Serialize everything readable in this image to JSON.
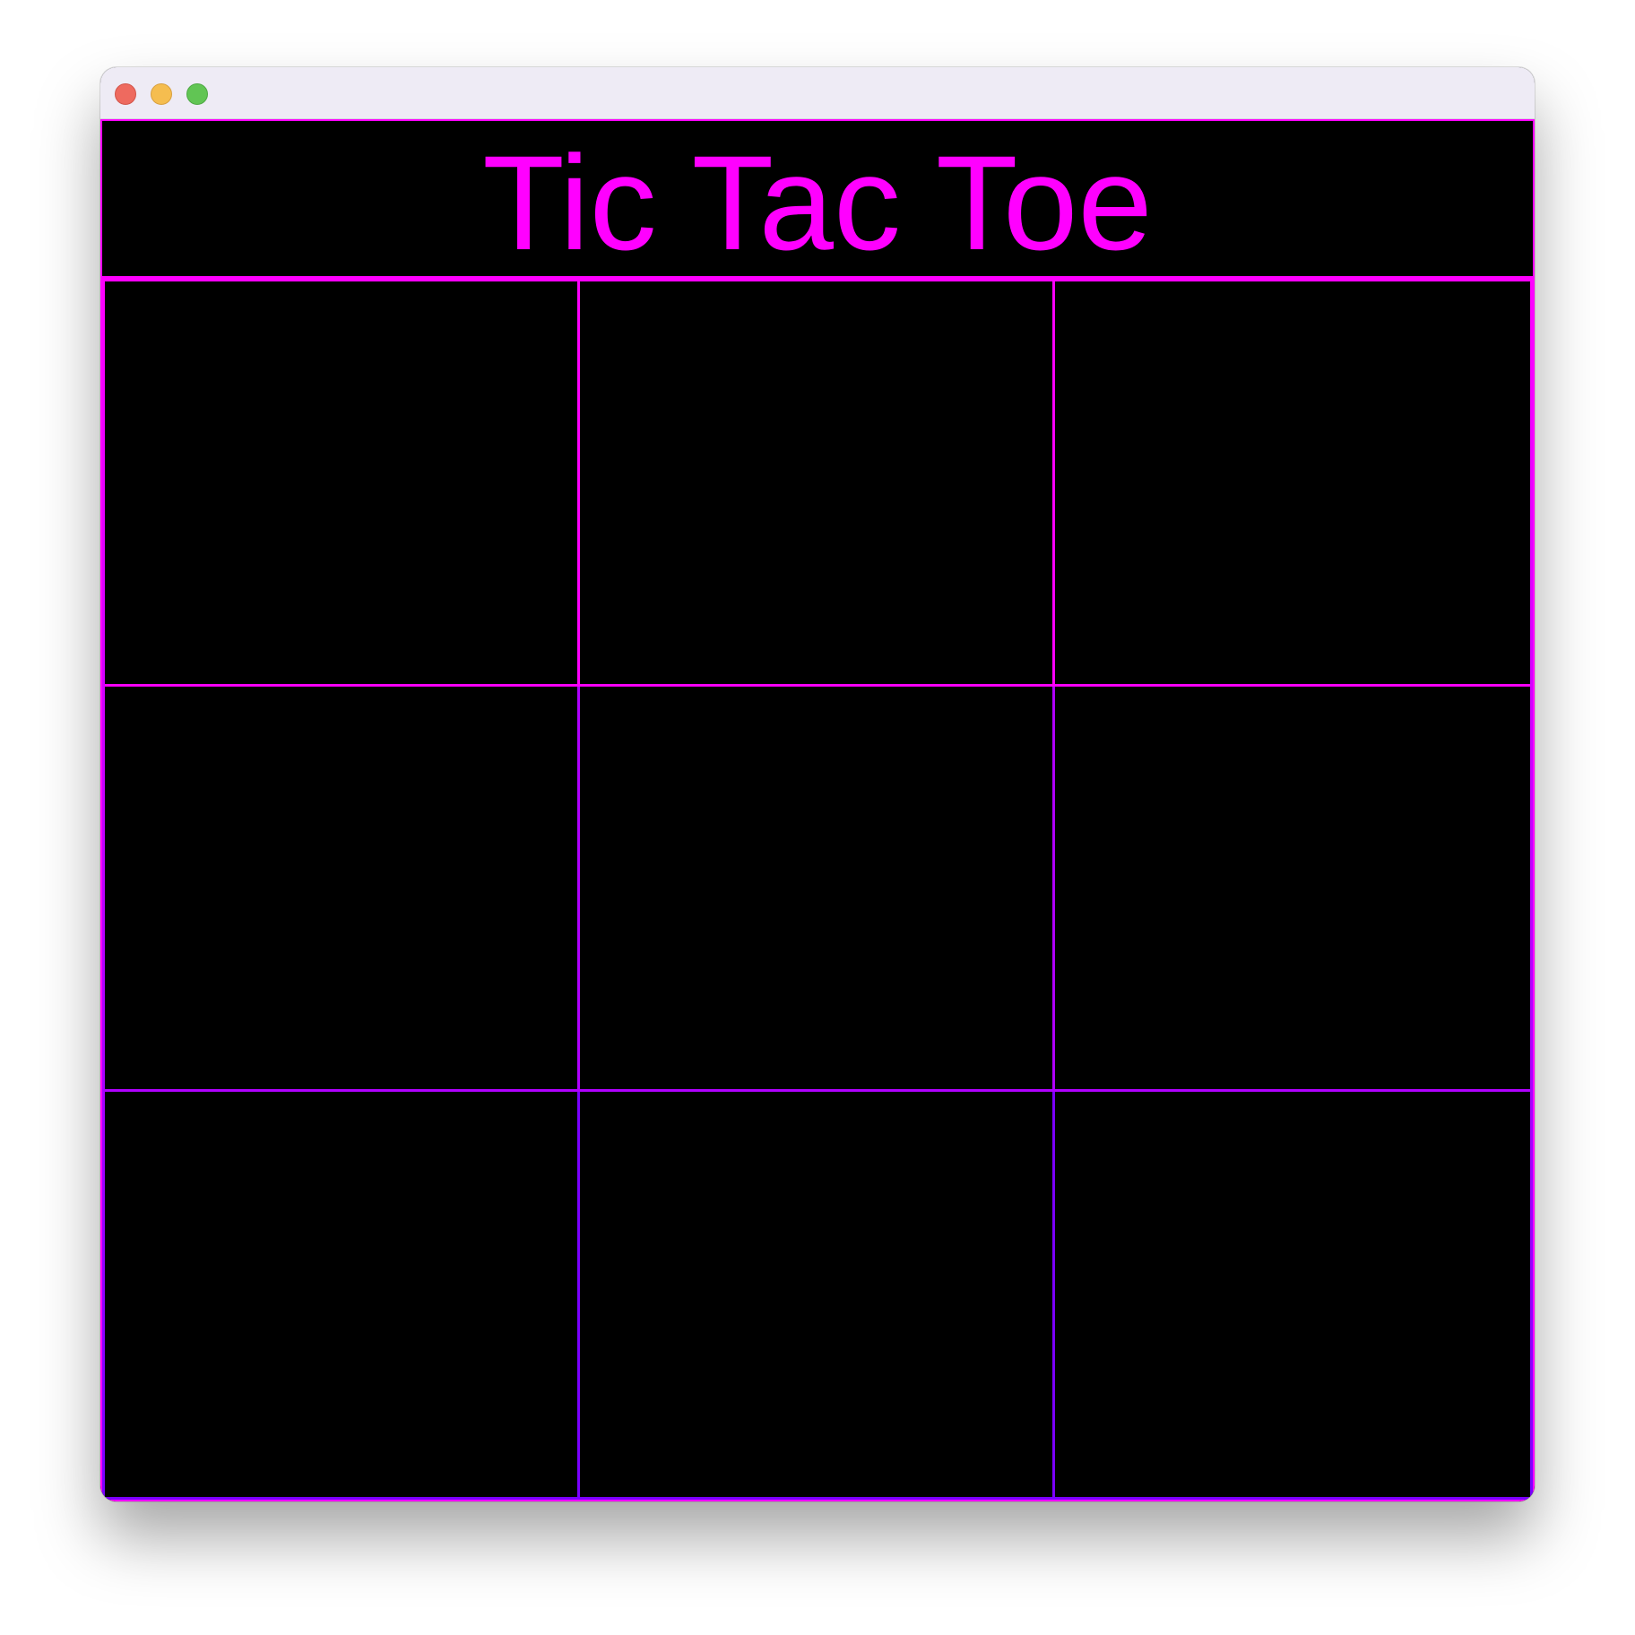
{
  "window": {
    "traffic_lights": [
      "close",
      "minimize",
      "maximize"
    ],
    "colors": {
      "close": "#ee6a5f",
      "minimize": "#f5bd4f",
      "maximize": "#61c554"
    }
  },
  "game": {
    "title": "Tic Tac Toe",
    "accent_color": "#ff00ff",
    "grid_gradient": [
      "#ff00ff",
      "#7a00ff"
    ],
    "background_color": "#000000",
    "board": [
      [
        "",
        "",
        ""
      ],
      [
        "",
        "",
        ""
      ],
      [
        "",
        "",
        ""
      ]
    ]
  }
}
